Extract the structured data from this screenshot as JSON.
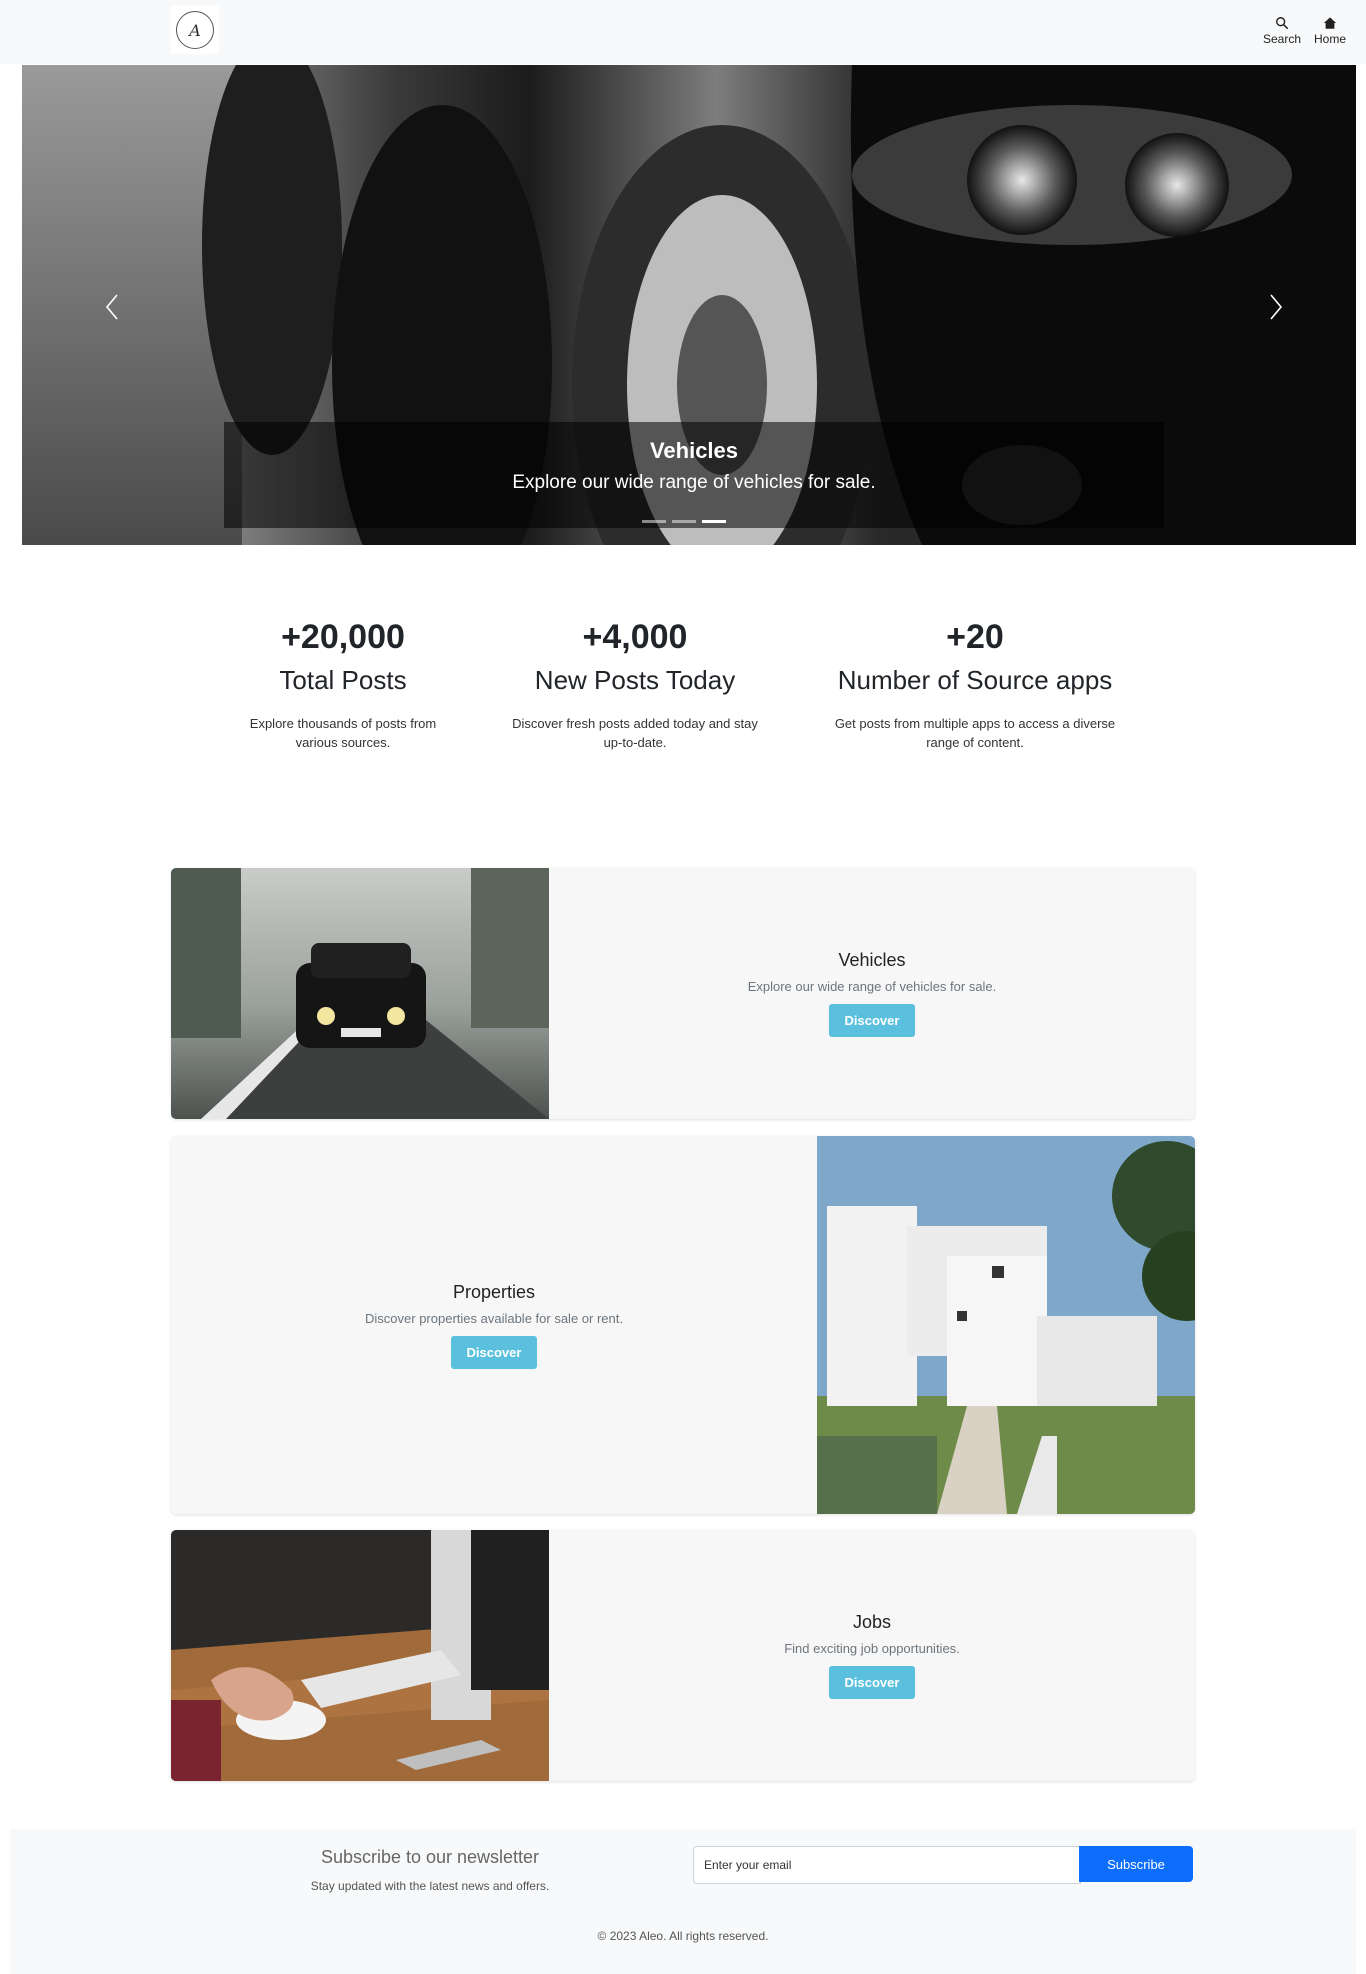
{
  "nav": {
    "logo_letter": "A",
    "search_label": "Search",
    "home_label": "Home"
  },
  "hero": {
    "title": "Vehicles",
    "text": "Explore our wide range of vehicles for sale.",
    "slide_count": 3,
    "active_slide": 3
  },
  "stats": [
    {
      "value": "+20,000",
      "label": "Total Posts",
      "desc": "Explore thousands of posts from various sources."
    },
    {
      "value": "+4,000",
      "label": "New Posts Today",
      "desc": "Discover fresh posts added today and stay up-to-date."
    },
    {
      "value": "+20",
      "label": "Number of Source apps",
      "desc": "Get posts from multiple apps to access a diverse range of content."
    }
  ],
  "categories": [
    {
      "title": "Vehicles",
      "text": "Explore our wide range of vehicles for sale.",
      "button": "Discover"
    },
    {
      "title": "Properties",
      "text": "Discover properties available for sale or rent.",
      "button": "Discover"
    },
    {
      "title": "Jobs",
      "text": "Find exciting job opportunities.",
      "button": "Discover"
    }
  ],
  "newsletter": {
    "title": "Subscribe to our newsletter",
    "text": "Stay updated with the latest news and offers.",
    "placeholder": "Enter your email",
    "button": "Subscribe"
  },
  "footer": {
    "copyright": "© 2023 Aleo. All rights reserved."
  },
  "colors": {
    "navbar_bg": "#f8f9fa",
    "discover_button": "#5bc0de",
    "subscribe_button": "#0d6efd",
    "card_bg": "#f7f7f7"
  }
}
